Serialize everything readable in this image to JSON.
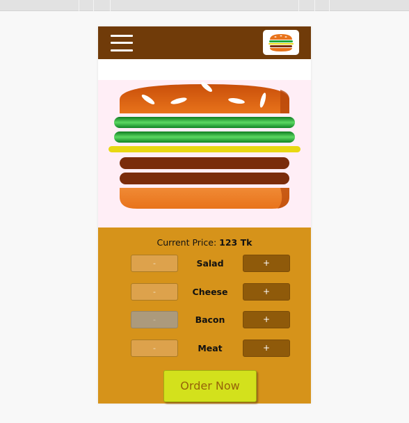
{
  "header": {
    "menu_icon": "hamburger-menu-icon",
    "logo_icon": "burger-logo-icon"
  },
  "price": {
    "label": "Current Price:",
    "value": "123 Tk"
  },
  "ingredients": [
    {
      "key": "salad",
      "label": "Salad",
      "less_label": "-",
      "more_label": "+",
      "less_disabled": false,
      "count": 2
    },
    {
      "key": "cheese",
      "label": "Cheese",
      "less_label": "-",
      "more_label": "+",
      "less_disabled": false,
      "count": 1
    },
    {
      "key": "bacon",
      "label": "Bacon",
      "less_label": "-",
      "more_label": "+",
      "less_disabled": true,
      "count": 0
    },
    {
      "key": "meat",
      "label": "Meat",
      "less_label": "-",
      "more_label": "+",
      "less_disabled": false,
      "count": 2
    }
  ],
  "order_button": "Order Now",
  "colors": {
    "toolbar": "#703B09",
    "controls_bg": "#D6931A",
    "burger_bg": "#ffeef6",
    "order_button": "#D3E11C",
    "bun": "#E8731B",
    "salad": "#22A83A",
    "cheese": "#E8D812",
    "meat": "#7A2C0B"
  }
}
